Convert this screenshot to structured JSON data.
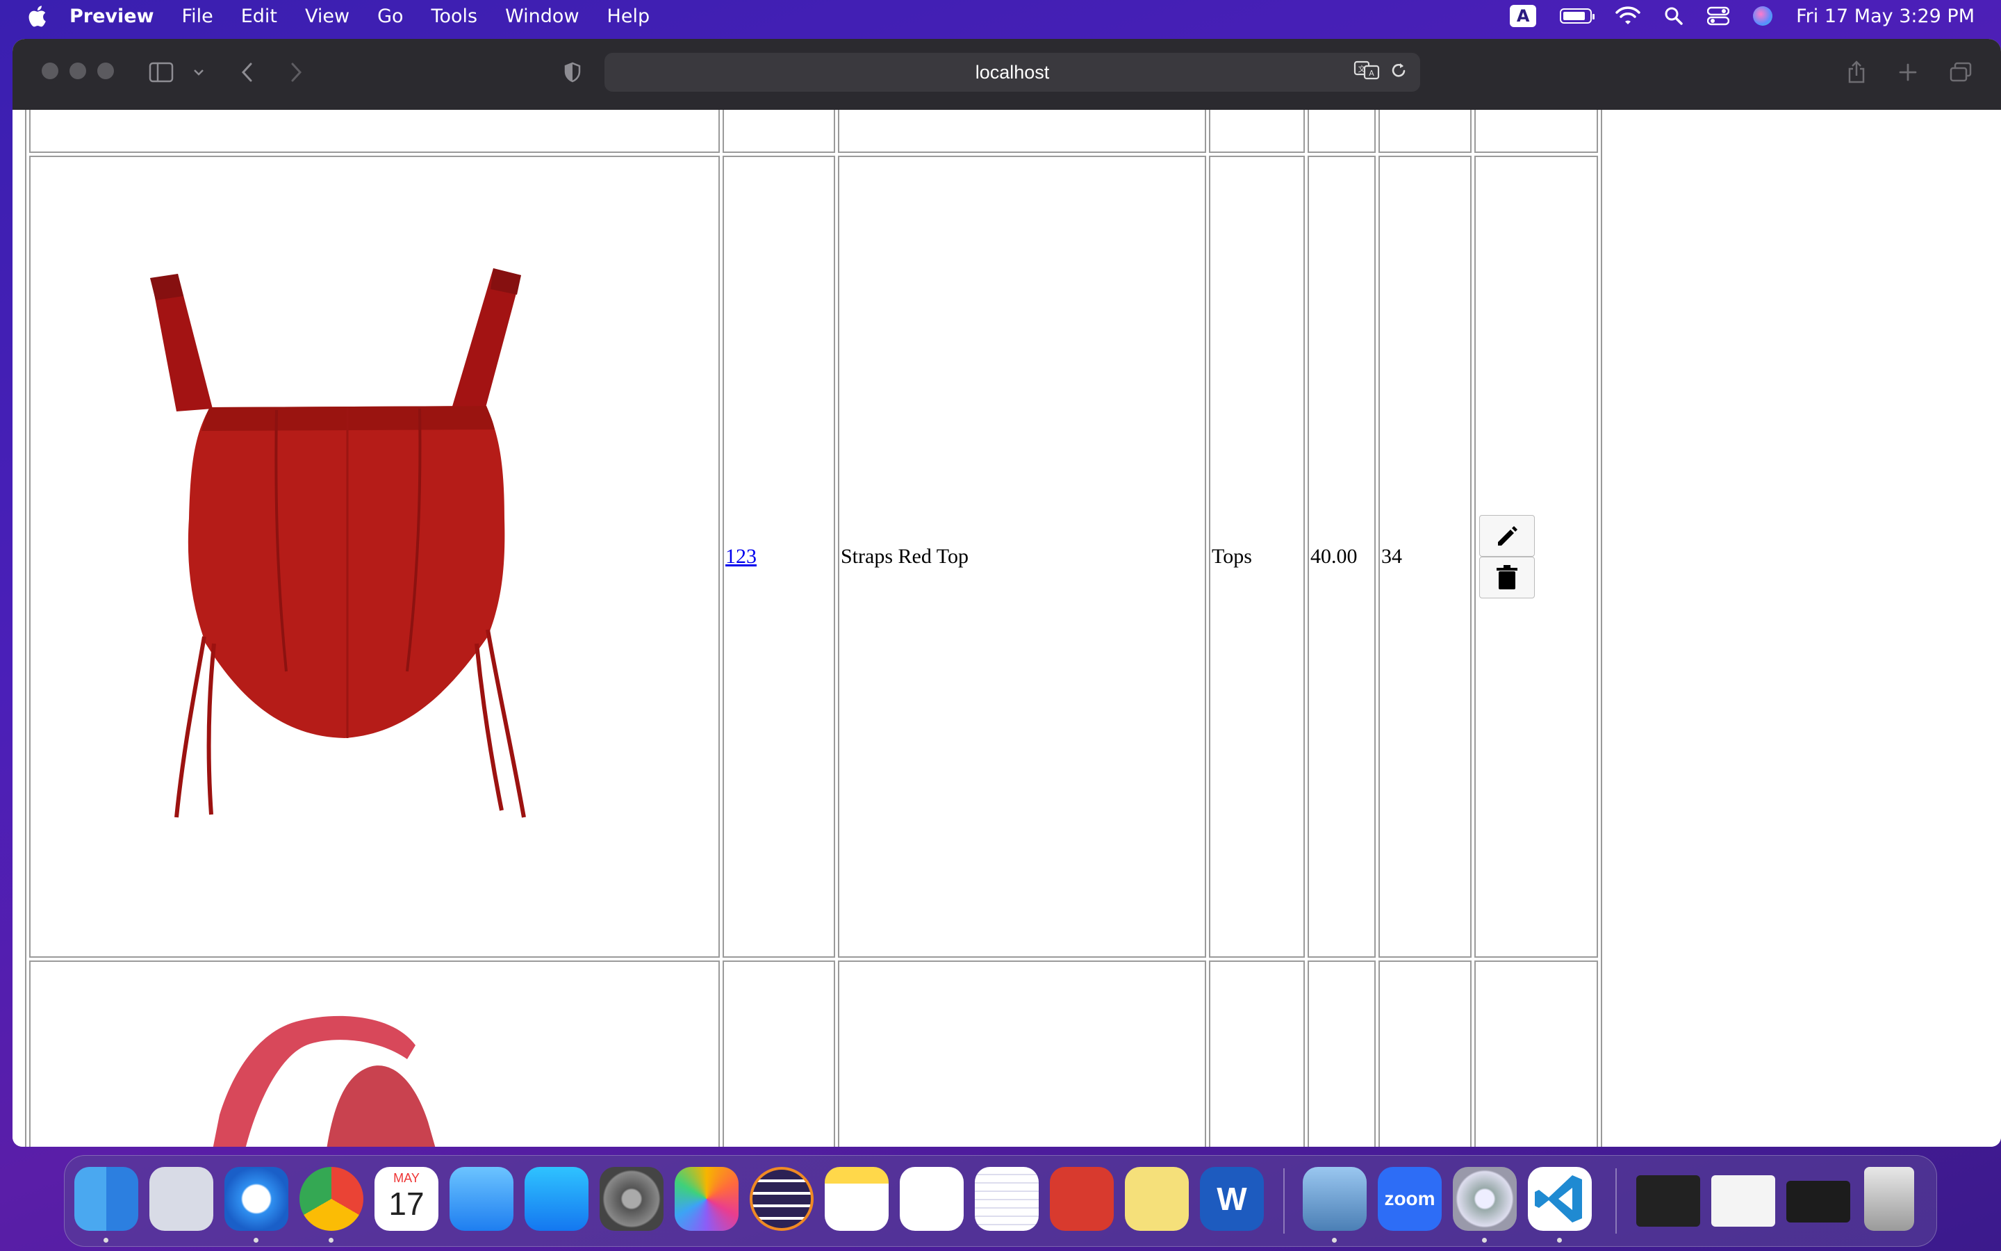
{
  "menubar": {
    "app_name": "Preview",
    "menus": [
      "File",
      "Edit",
      "View",
      "Go",
      "Tools",
      "Window",
      "Help"
    ],
    "input_badge": "A",
    "datetime": "Fri 17 May  3:29 PM"
  },
  "browser": {
    "url": "localhost"
  },
  "table": {
    "row": {
      "id": "123",
      "name": "Straps Red Top",
      "category": "Tops",
      "price": "40.00",
      "quantity": "34"
    }
  },
  "dock": {
    "calendar_month": "MAY",
    "calendar_day": "17",
    "zoom_label": "zoom",
    "word_label": "W",
    "apps": [
      "finder-icon",
      "launchpad-icon",
      "safari-icon",
      "chrome-icon",
      "calendar-icon",
      "mail-icon",
      "app-store-icon",
      "system-settings-icon",
      "photos-icon",
      "eclipse-icon",
      "notes-icon",
      "freeform-icon",
      "textedit-icon",
      "photo-booth-icon",
      "stickies-icon",
      "word-icon",
      "preview-icon",
      "zoom-icon",
      "settings-icon",
      "vscode-icon",
      "trash-icon"
    ]
  }
}
